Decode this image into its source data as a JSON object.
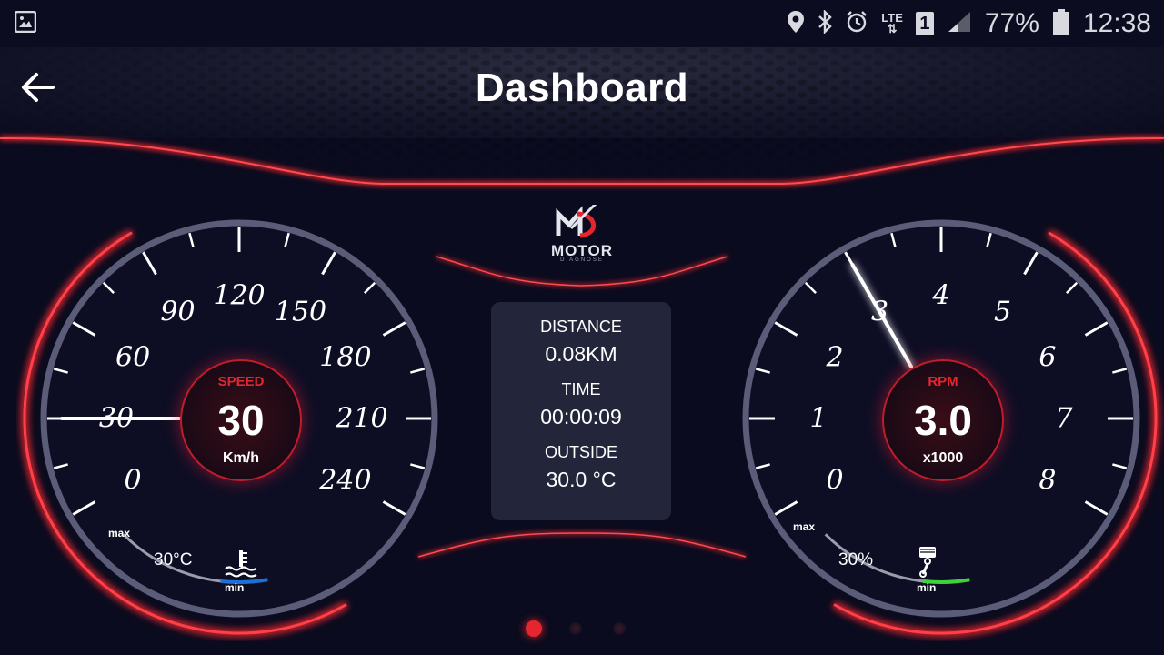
{
  "status_bar": {
    "battery": "77%",
    "time": "12:38",
    "network": "LTE",
    "sim": "1",
    "icons": [
      "gallery-icon",
      "location-icon",
      "bluetooth-icon",
      "alarm-icon",
      "signal-icon",
      "battery-icon"
    ]
  },
  "header": {
    "title": "Dashboard",
    "back_icon": "arrow-left-icon"
  },
  "logo": {
    "name": "MOTOR",
    "sub": "DIAGNOSE"
  },
  "speed_gauge": {
    "label": "SPEED",
    "value": "30",
    "unit": "Km/h",
    "ticks": [
      "0",
      "30",
      "60",
      "90",
      "120",
      "150",
      "180",
      "210",
      "240"
    ],
    "needle_value": 30,
    "scale_max": 240,
    "temp": {
      "value": "30°C",
      "max_label": "max",
      "min_label": "min",
      "icon": "coolant-temp-icon"
    }
  },
  "rpm_gauge": {
    "label": "RPM",
    "value": "3.0",
    "unit": "x1000",
    "ticks": [
      "0",
      "1",
      "2",
      "3",
      "4",
      "5",
      "6",
      "7",
      "8"
    ],
    "needle_value": 3.0,
    "scale_max": 8,
    "load": {
      "value": "30%",
      "max_label": "max",
      "min_label": "min",
      "icon": "engine-piston-icon"
    }
  },
  "info_panel": {
    "distance_label": "DISTANCE",
    "distance_value": "0.08KM",
    "time_label": "TIME",
    "time_value": "00:00:09",
    "outside_label": "OUTSIDE",
    "outside_value": "30.0 °C"
  },
  "pager": {
    "pages": 3,
    "active": 1
  },
  "colors": {
    "accent": "#e5262e",
    "background": "#0a0b1e",
    "panel": "#23263a",
    "ring": "#5a5c78",
    "temp_bar": "#1e6fd8",
    "load_bar": "#3fd23a"
  }
}
